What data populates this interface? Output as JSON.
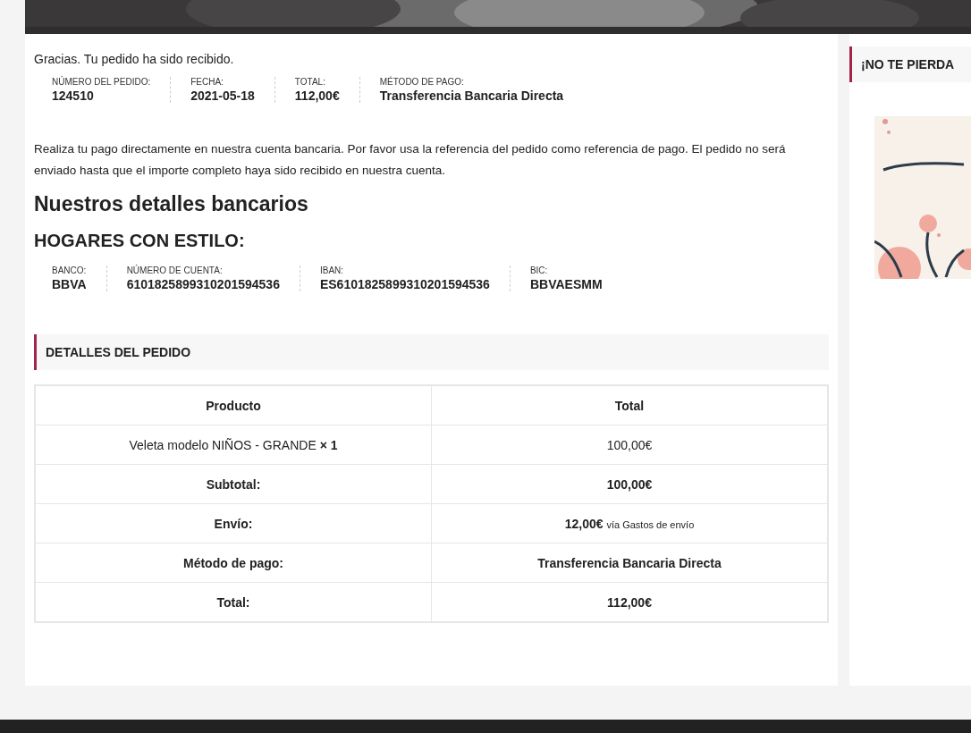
{
  "thanks": "Gracias. Tu pedido ha sido recibido.",
  "order_overview": [
    {
      "label": "NÚMERO DEL PEDIDO:",
      "value": "124510"
    },
    {
      "label": "FECHA:",
      "value": "2021-05-18"
    },
    {
      "label": "TOTAL:",
      "value": "112,00€"
    },
    {
      "label": "MÉTODO DE PAGO:",
      "value": "Transferencia Bancaria Directa"
    }
  ],
  "instructions": "Realiza tu pago directamente en nuestra cuenta bancaria. Por favor usa la referencia del pedido como referencia de pago. El pedido no será enviado hasta que el importe completo haya sido recibido en nuestra cuenta.",
  "bank_heading": "Nuestros detalles bancarios",
  "account_name": "HOGARES CON ESTILO:",
  "bank_details": [
    {
      "label": "BANCO:",
      "value": "BBVA"
    },
    {
      "label": "NÚMERO DE CUENTA:",
      "value": "6101825899310201594536"
    },
    {
      "label": "IBAN:",
      "value": "ES6101825899310201594536"
    },
    {
      "label": "BIC:",
      "value": "BBVAESMM"
    }
  ],
  "order_details": {
    "title": "DETALLES DEL PEDIDO",
    "columns": [
      "Producto",
      "Total"
    ],
    "rows": [
      {
        "kind": "item",
        "label": "Veleta modelo NIÑOS - GRANDE **× 1**",
        "value": "100,00€"
      },
      {
        "kind": "total",
        "label": "Subtotal:",
        "value": "100,00€"
      },
      {
        "kind": "total",
        "label": "Envío:",
        "value": "12,00€",
        "note": "vía Gastos de envío"
      },
      {
        "kind": "total",
        "label": "Método de pago:",
        "value": "Transferencia Bancaria Directa"
      },
      {
        "kind": "total",
        "label": "Total:",
        "value": "112,00€"
      }
    ]
  },
  "sidebar": {
    "title": "¡NO TE PIERDA"
  }
}
